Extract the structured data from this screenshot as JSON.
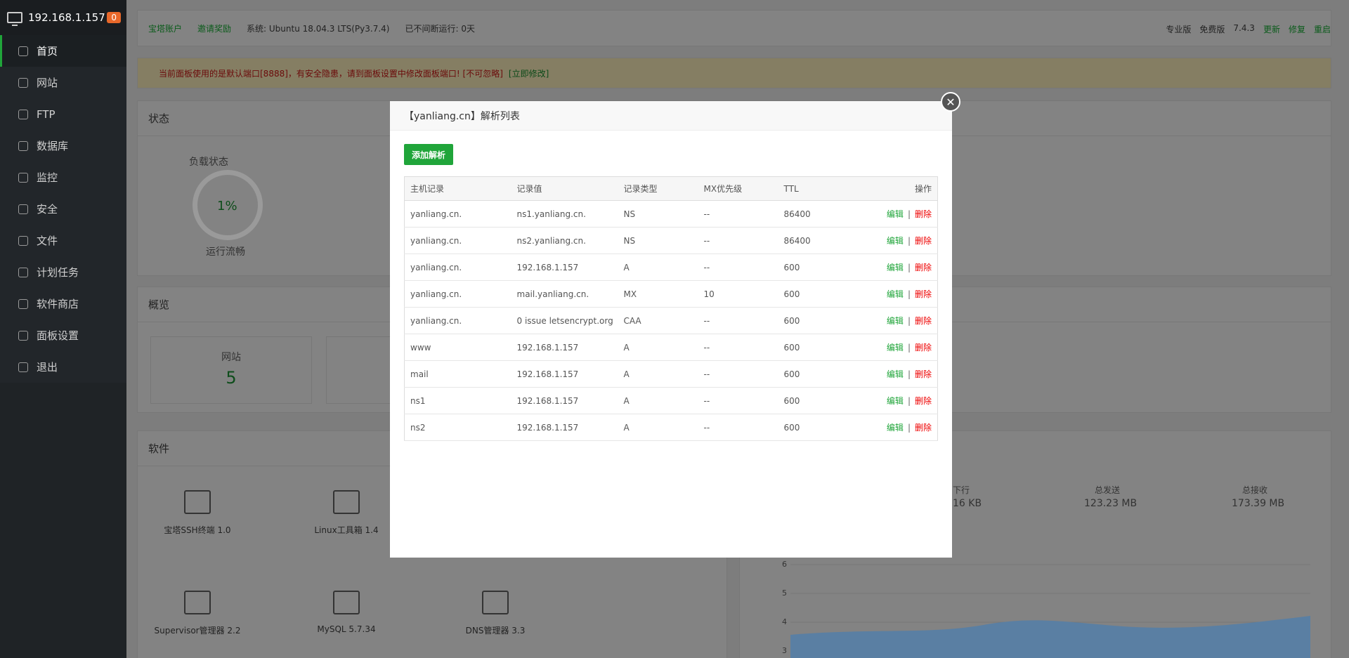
{
  "sidebar": {
    "ip": "192.168.1.157",
    "badge": "0",
    "items": [
      {
        "label": "首页",
        "icon": "home-icon"
      },
      {
        "label": "网站",
        "icon": "globe-icon"
      },
      {
        "label": "FTP",
        "icon": "ftp-icon"
      },
      {
        "label": "数据库",
        "icon": "database-icon"
      },
      {
        "label": "监控",
        "icon": "monitor-icon"
      },
      {
        "label": "安全",
        "icon": "shield-icon"
      },
      {
        "label": "文件",
        "icon": "folder-icon"
      },
      {
        "label": "计划任务",
        "icon": "task-icon"
      },
      {
        "label": "软件商店",
        "icon": "store-icon"
      },
      {
        "label": "面板设置",
        "icon": "gear-icon"
      },
      {
        "label": "退出",
        "icon": "logout-icon"
      }
    ]
  },
  "topbar": {
    "account": "宝塔账户",
    "invite": "邀请奖励",
    "system": "系统:  Ubuntu 18.04.3 LTS(Py3.7.4)",
    "uptime": "已不间断运行: 0天",
    "pro": "专业版",
    "free": "免费版",
    "version": "7.4.3",
    "update": "更新",
    "repair": "修复",
    "restart": "重启"
  },
  "warning": {
    "text": "当前面板使用的是默认端口[8888]，有安全隐患，请到面板设置中修改面板端口! [不可忽略]",
    "link": "[立即修改]"
  },
  "status": {
    "title": "状态",
    "load_label": "负载状态",
    "load_value": "1%",
    "load_text": "运行流畅"
  },
  "overview": {
    "title": "概览",
    "site_label": "网站",
    "site_count": "5"
  },
  "software": {
    "title": "软件",
    "items": [
      "宝塔SSH终端 1.0",
      "Linux工具箱 1.4",
      "Supervisor管理器 2.2",
      "MySQL 5.7.34",
      "DNS管理器 3.3"
    ]
  },
  "traffic": {
    "down_label": "下行",
    "down_value": "16 KB",
    "sent_label": "总发送",
    "sent_value": "123.23 MB",
    "recv_label": "总接收",
    "recv_value": "173.39 MB",
    "y_ticks": [
      "6",
      "5",
      "4",
      "3"
    ]
  },
  "modal": {
    "title": "【yanliang.cn】解析列表",
    "add_label": "添加解析",
    "columns": [
      "主机记录",
      "记录值",
      "记录类型",
      "MX优先级",
      "TTL",
      "操作"
    ],
    "edit_label": "编辑",
    "delete_label": "删除",
    "rows": [
      [
        "yanliang.cn.",
        "ns1.yanliang.cn.",
        "NS",
        "--",
        "86400"
      ],
      [
        "yanliang.cn.",
        "ns2.yanliang.cn.",
        "NS",
        "--",
        "86400"
      ],
      [
        "yanliang.cn.",
        "192.168.1.157",
        "A",
        "--",
        "600"
      ],
      [
        "yanliang.cn.",
        "mail.yanliang.cn.",
        "MX",
        "10",
        "600"
      ],
      [
        "yanliang.cn.",
        "0 issue letsencrypt.org",
        "CAA",
        "--",
        "600"
      ],
      [
        "www",
        "192.168.1.157",
        "A",
        "--",
        "600"
      ],
      [
        "mail",
        "192.168.1.157",
        "A",
        "--",
        "600"
      ],
      [
        "ns1",
        "192.168.1.157",
        "A",
        "--",
        "600"
      ],
      [
        "ns2",
        "192.168.1.157",
        "A",
        "--",
        "600"
      ]
    ]
  }
}
